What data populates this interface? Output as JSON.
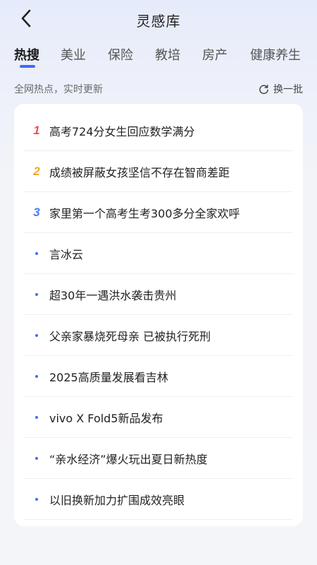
{
  "header": {
    "title": "灵感库"
  },
  "tabs": [
    {
      "label": "热搜",
      "active": true
    },
    {
      "label": "美业",
      "active": false
    },
    {
      "label": "保险",
      "active": false
    },
    {
      "label": "教培",
      "active": false
    },
    {
      "label": "房产",
      "active": false
    },
    {
      "label": "健康养生",
      "active": false
    }
  ],
  "subbar": {
    "subtitle": "全网热点，实时更新",
    "refresh_label": "换一批"
  },
  "list": [
    {
      "rank": "1",
      "text": "高考724分女生回应数学满分"
    },
    {
      "rank": "2",
      "text": "成绩被屏蔽女孩坚信不存在智商差距"
    },
    {
      "rank": "3",
      "text": "家里第一个高考生考300多分全家欢呼"
    },
    {
      "rank": "",
      "text": "言冰云"
    },
    {
      "rank": "",
      "text": "超30年一遇洪水袭击贵州"
    },
    {
      "rank": "",
      "text": "父亲家暴烧死母亲 已被执行死刑"
    },
    {
      "rank": "",
      "text": "2025高质量发展看吉林"
    },
    {
      "rank": "",
      "text": "vivo X Fold5新品发布"
    },
    {
      "rank": "",
      "text": "“亲水经济”爆火玩出夏日新热度"
    },
    {
      "rank": "",
      "text": "以旧换新加力扩围成效亮眼"
    }
  ],
  "colors": {
    "rank1": "#f24e4e",
    "rank2": "#f5a623",
    "rank3": "#4a7bf7",
    "accent": "#3f6cf6"
  }
}
